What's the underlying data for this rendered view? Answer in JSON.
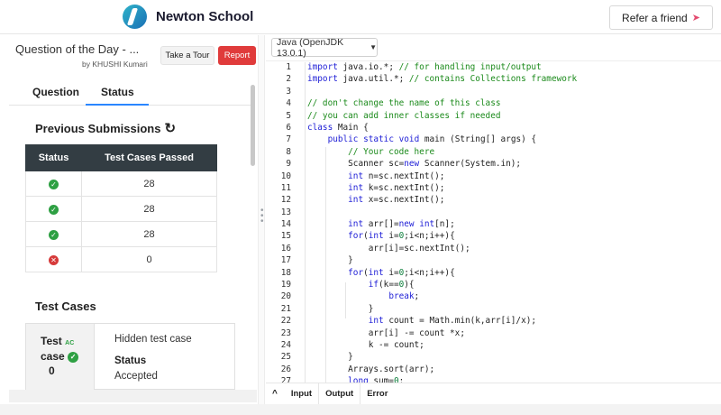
{
  "header": {
    "brand": "Newton School",
    "refer_label": "Refer a friend",
    "rocket_icon": "rocket-icon"
  },
  "question": {
    "title": "Question of the Day - ...",
    "author": "by KHUSHI Kumari",
    "tour_label": "Take a Tour",
    "report_label": "Report"
  },
  "tabs": {
    "question": "Question",
    "status": "Status",
    "active": "Status"
  },
  "submissions": {
    "title": "Previous Submissions",
    "col_status": "Status",
    "col_passed": "Test Cases Passed",
    "rows": [
      {
        "status": "passed",
        "passed": "28"
      },
      {
        "status": "passed",
        "passed": "28"
      },
      {
        "status": "passed",
        "passed": "28"
      },
      {
        "status": "failed",
        "passed": "0"
      }
    ]
  },
  "testcases": {
    "title": "Test Cases",
    "label_line1": "Test",
    "ac": "AC",
    "label_line2": "case",
    "number": "0",
    "hidden": "Hidden test case",
    "status_label": "Status",
    "status_value": "Accepted"
  },
  "editor": {
    "language": "Java (OpenJDK 13.0.1)",
    "lines": [
      "import java.io.*; // for handling input/output",
      "import java.util.*; // contains Collections framework",
      "",
      "// don't change the name of this class",
      "// you can add inner classes if needed",
      "class Main {",
      "    public static void main (String[] args) {",
      "        // Your code here",
      "        Scanner sc=new Scanner(System.in);",
      "        int n=sc.nextInt();",
      "        int k=sc.nextInt();",
      "        int x=sc.nextInt();",
      "",
      "        int arr[]=new int[n];",
      "        for(int i=0;i<n;i++){",
      "            arr[i]=sc.nextInt();",
      "        }",
      "        for(int i=0;i<n;i++){",
      "            if(k==0){",
      "                break;",
      "            }",
      "            int count = Math.min(k,arr[i]/x);",
      "            arr[i] -= count *x;",
      "            k -= count;",
      "        }",
      "        Arrays.sort(arr);",
      "        long sum=0;"
    ]
  },
  "console": {
    "input": "Input",
    "output": "Output",
    "error": "Error"
  }
}
